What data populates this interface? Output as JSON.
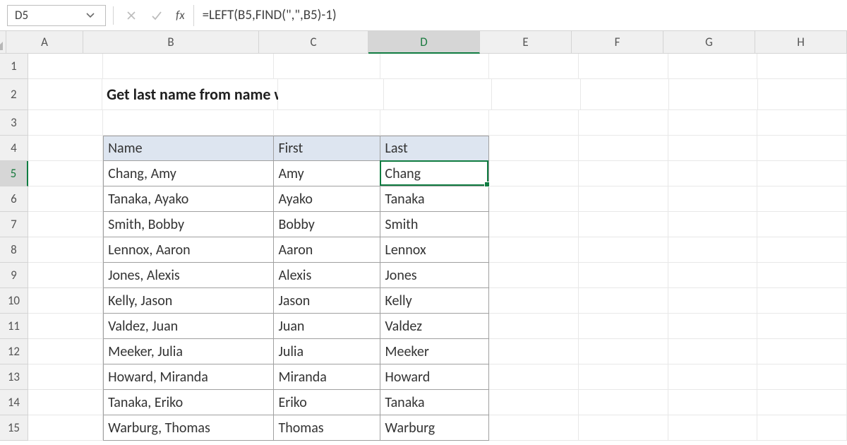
{
  "nameBox": "D5",
  "formula": "=LEFT(B5,FIND(\",\",B5)-1)",
  "fxLabel": "fx",
  "columns": [
    "A",
    "B",
    "C",
    "D",
    "E",
    "F",
    "G",
    "H"
  ],
  "activeCol": "D",
  "activeRow": 5,
  "title": "Get last name from name with comma",
  "tableHeaders": {
    "name": "Name",
    "first": "First",
    "last": "Last"
  },
  "rows": [
    {
      "name": "Chang, Amy",
      "first": "Amy",
      "last": "Chang"
    },
    {
      "name": "Tanaka, Ayako",
      "first": "Ayako",
      "last": "Tanaka"
    },
    {
      "name": "Smith, Bobby",
      "first": "Bobby",
      "last": "Smith"
    },
    {
      "name": "Lennox, Aaron",
      "first": "Aaron",
      "last": "Lennox"
    },
    {
      "name": "Jones, Alexis",
      "first": "Alexis",
      "last": "Jones"
    },
    {
      "name": "Kelly, Jason",
      "first": "Jason",
      "last": "Kelly"
    },
    {
      "name": "Valdez, Juan",
      "first": "Juan",
      "last": "Valdez"
    },
    {
      "name": "Meeker, Julia",
      "first": "Julia",
      "last": "Meeker"
    },
    {
      "name": "Howard, Miranda",
      "first": "Miranda",
      "last": "Howard"
    },
    {
      "name": "Tanaka, Eriko",
      "first": "Eriko",
      "last": "Tanaka"
    },
    {
      "name": "Warburg, Thomas",
      "first": "Thomas",
      "last": "Warburg"
    }
  ]
}
